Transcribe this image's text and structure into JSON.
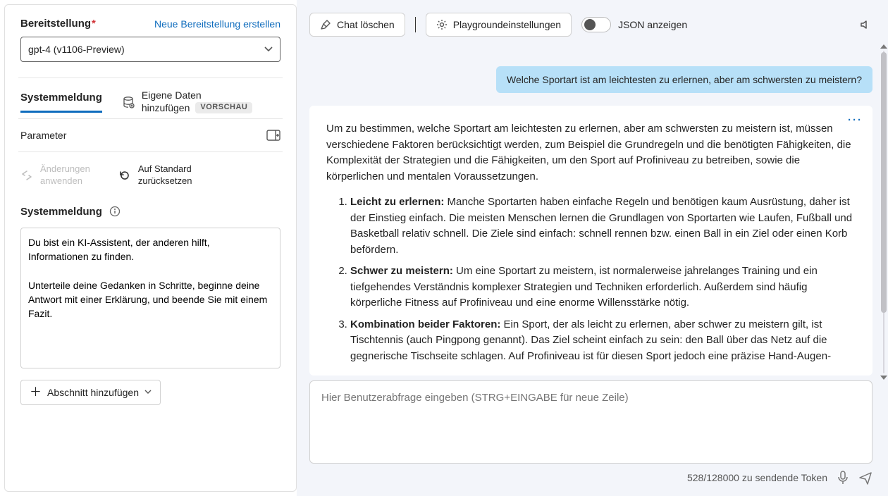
{
  "left": {
    "deployment_label": "Bereitstellung",
    "new_deployment": "Neue Bereitstellung erstellen",
    "selected_model": "gpt-4 (v1106-Preview)",
    "tab_system": "Systemmeldung",
    "own_data_line1": "Eigene Daten",
    "own_data_line2": "hinzufügen",
    "preview_pill": "VORSCHAU",
    "parameter_label": "Parameter",
    "apply_changes_l1": "Änderungen",
    "apply_changes_l2": "anwenden",
    "reset_l1": "Auf Standard",
    "reset_l2": "zurücksetzen",
    "system_message_heading": "Systemmeldung",
    "system_message_value": "Du bist ein KI-Assistent, der anderen hilft, Informationen zu finden.\n\nUnterteile deine Gedanken in Schritte, beginne deine Antwort mit einer Erklärung, und beende Sie mit einem Fazit.",
    "add_section": "Abschnitt hinzufügen"
  },
  "toolbar": {
    "clear_chat": "Chat löschen",
    "playground_settings": "Playgroundeinstellungen",
    "show_json": "JSON anzeigen"
  },
  "chat": {
    "user_msg": "Welche Sportart ist am leichtesten zu erlernen, aber am schwersten zu meistern?",
    "ai_intro": "Um zu bestimmen, welche Sportart am leichtesten zu erlernen, aber am schwersten zu meistern ist, müssen verschiedene Faktoren berücksichtigt werden, zum Beispiel die Grundregeln und die benötigten Fähigkeiten, die Komplexität der Strategien und die Fähigkeiten, um den Sport auf Profiniveau zu betreiben, sowie die körperlichen und mentalen Voraussetzungen.",
    "item1_label": "Leicht zu erlernen:",
    "item1_body": " Manche Sportarten haben einfache Regeln und benötigen kaum Ausrüstung, daher ist der Einstieg einfach. Die meisten Menschen lernen die Grundlagen von Sportarten wie Laufen, Fußball und Basketball relativ schnell. Die Ziele sind einfach: schnell rennen bzw. einen Ball in ein Ziel oder einen Korb befördern.",
    "item2_label": "Schwer zu meistern:",
    "item2_body": " Um eine Sportart zu meistern, ist normalerweise jahrelanges Training und ein tiefgehendes Verständnis komplexer Strategien und Techniken erforderlich. Außerdem sind häufig körperliche Fitness auf Profiniveau und eine enorme Willensstärke nötig.",
    "item3_label": "Kombination beider Faktoren:",
    "item3_body": " Ein Sport, der als leicht zu erlernen, aber schwer zu meistern gilt, ist Tischtennis (auch Pingpong genannt). Das Ziel scheint einfach zu sein: den Ball über das Netz auf die gegnerische Tischseite schlagen. Auf Profiniveau ist für diesen Sport jedoch eine präzise Hand-Augen-"
  },
  "compose": {
    "placeholder": "Hier Benutzerabfrage eingeben (STRG+EINGABE für neue Zeile)"
  },
  "footer": {
    "token_text": "528/128000 zu sendende Token"
  }
}
